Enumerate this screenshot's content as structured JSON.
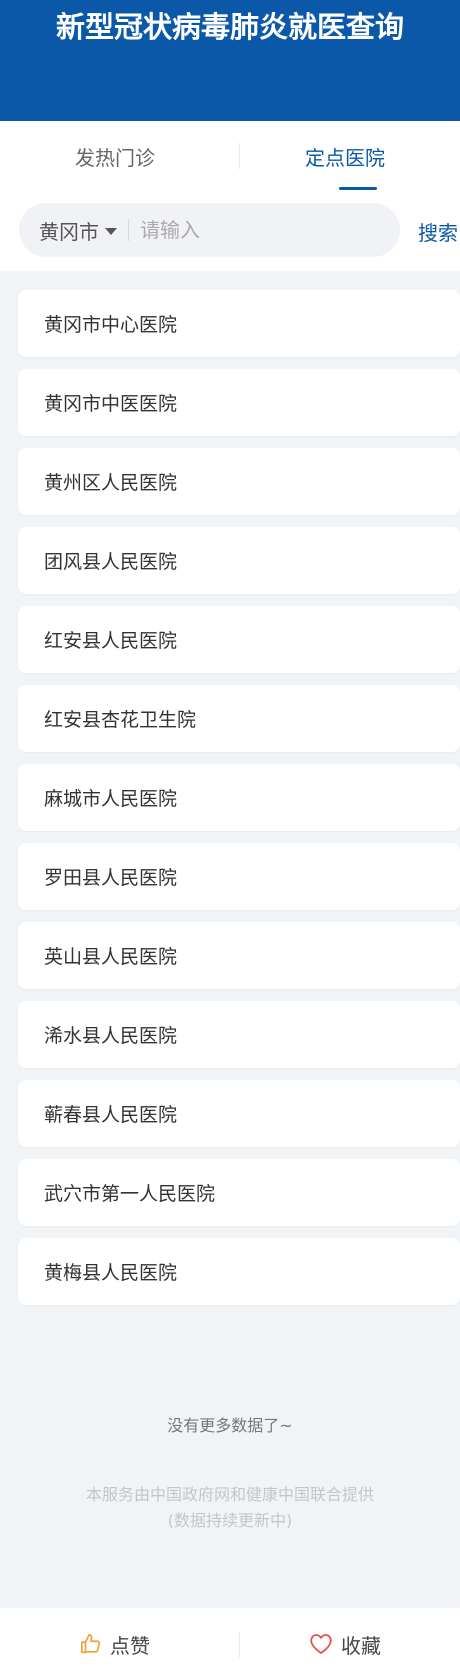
{
  "header": {
    "title": "新型冠状病毒肺炎就医查询"
  },
  "tabs": [
    {
      "label": "发热门诊",
      "active": false
    },
    {
      "label": "定点医院",
      "active": true
    }
  ],
  "search": {
    "city": "黄冈市",
    "placeholder": "请输入",
    "value": "",
    "button_label": "搜索"
  },
  "hospitals": [
    "黄冈市中心医院",
    "黄冈市中医医院",
    "黄州区人民医院",
    "团风县人民医院",
    "红安县人民医院",
    "红安县杏花卫生院",
    "麻城市人民医院",
    "罗田县人民医院",
    "英山县人民医院",
    "浠水县人民医院",
    "蕲春县人民医院",
    "武穴市第一人民医院",
    "黄梅县人民医院"
  ],
  "footer": {
    "no_more": "没有更多数据了~",
    "service_line1": "本服务由中国政府网和健康中国联合提供",
    "service_line2": "(数据持续更新中)"
  },
  "bottom_bar": {
    "like_label": "点赞",
    "collect_label": "收藏"
  },
  "colors": {
    "primary": "#0b58a8",
    "like_icon": "#f0a030",
    "collect_icon": "#e8504a"
  },
  "icons": {
    "like": "thumbs-up-icon",
    "collect": "heart-icon",
    "city_dropdown": "caret-down-icon"
  }
}
